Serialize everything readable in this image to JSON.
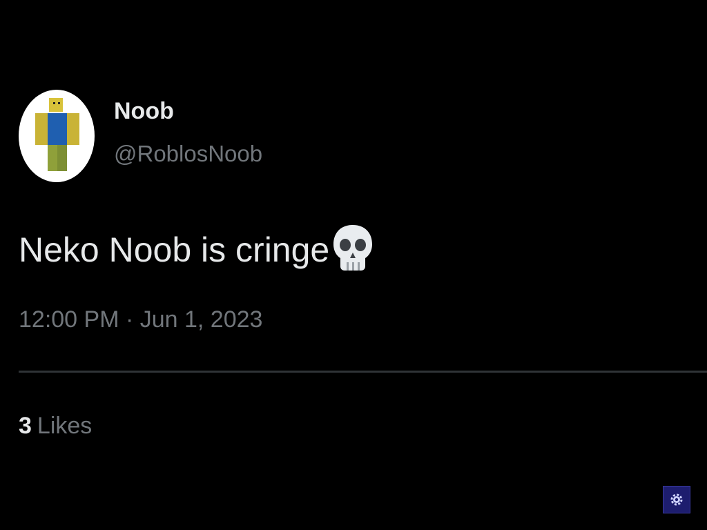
{
  "profile": {
    "display_name": "Noob",
    "handle": "@RoblosNoob",
    "avatar_icon": "roblox-noob-avatar"
  },
  "tweet": {
    "text": "Neko Noob is cringe",
    "emoji_icon": "skull-icon",
    "timestamp": "12:00 PM · Jun 1, 2023"
  },
  "stats": {
    "likes_count": "3",
    "likes_label": "Likes"
  },
  "overlay": {
    "corner_icon": "gear-icon"
  },
  "colors": {
    "background": "#000000",
    "primary_text": "#e7e9ea",
    "secondary_text": "#71767b",
    "divider": "#2f3336"
  }
}
